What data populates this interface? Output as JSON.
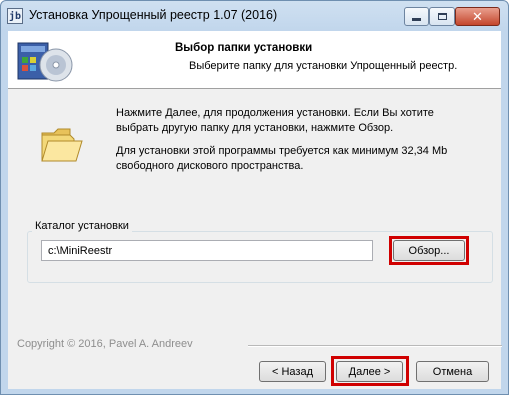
{
  "window": {
    "title": "Установка Упрощенный реестр 1.07 (2016)",
    "app_icon_glyph": "jb",
    "controls": {
      "minimize": "minimize-icon",
      "maximize": "maximize-icon",
      "close": "✕"
    }
  },
  "header": {
    "title": "Выбор папки установки",
    "subtitle": "Выберите папку для установки Упрощенный реестр."
  },
  "body": {
    "info_paragraph_1": [
      "Нажмите Далее, для продолжения установки. Если Вы хотите",
      "выбрать другую папку для установки, нажмите Обзор."
    ],
    "info_paragraph_2": [
      "Для установки этой программы требуется как минимум 32,34 Mb",
      "свободного дискового пространства."
    ],
    "install_dir": {
      "group_label": "Каталог установки",
      "value": "c:\\MiniReestr",
      "browse_label": "Обзор..."
    }
  },
  "footer": {
    "copyright": "Copyright © 2016, Pavel A. Andreev",
    "back_label": "< Назад",
    "next_label": "Далее >",
    "cancel_label": "Отмена"
  },
  "colors": {
    "highlight": "#d00000",
    "title_bar": "#c1d6ec",
    "close_button": "#c4462c"
  }
}
